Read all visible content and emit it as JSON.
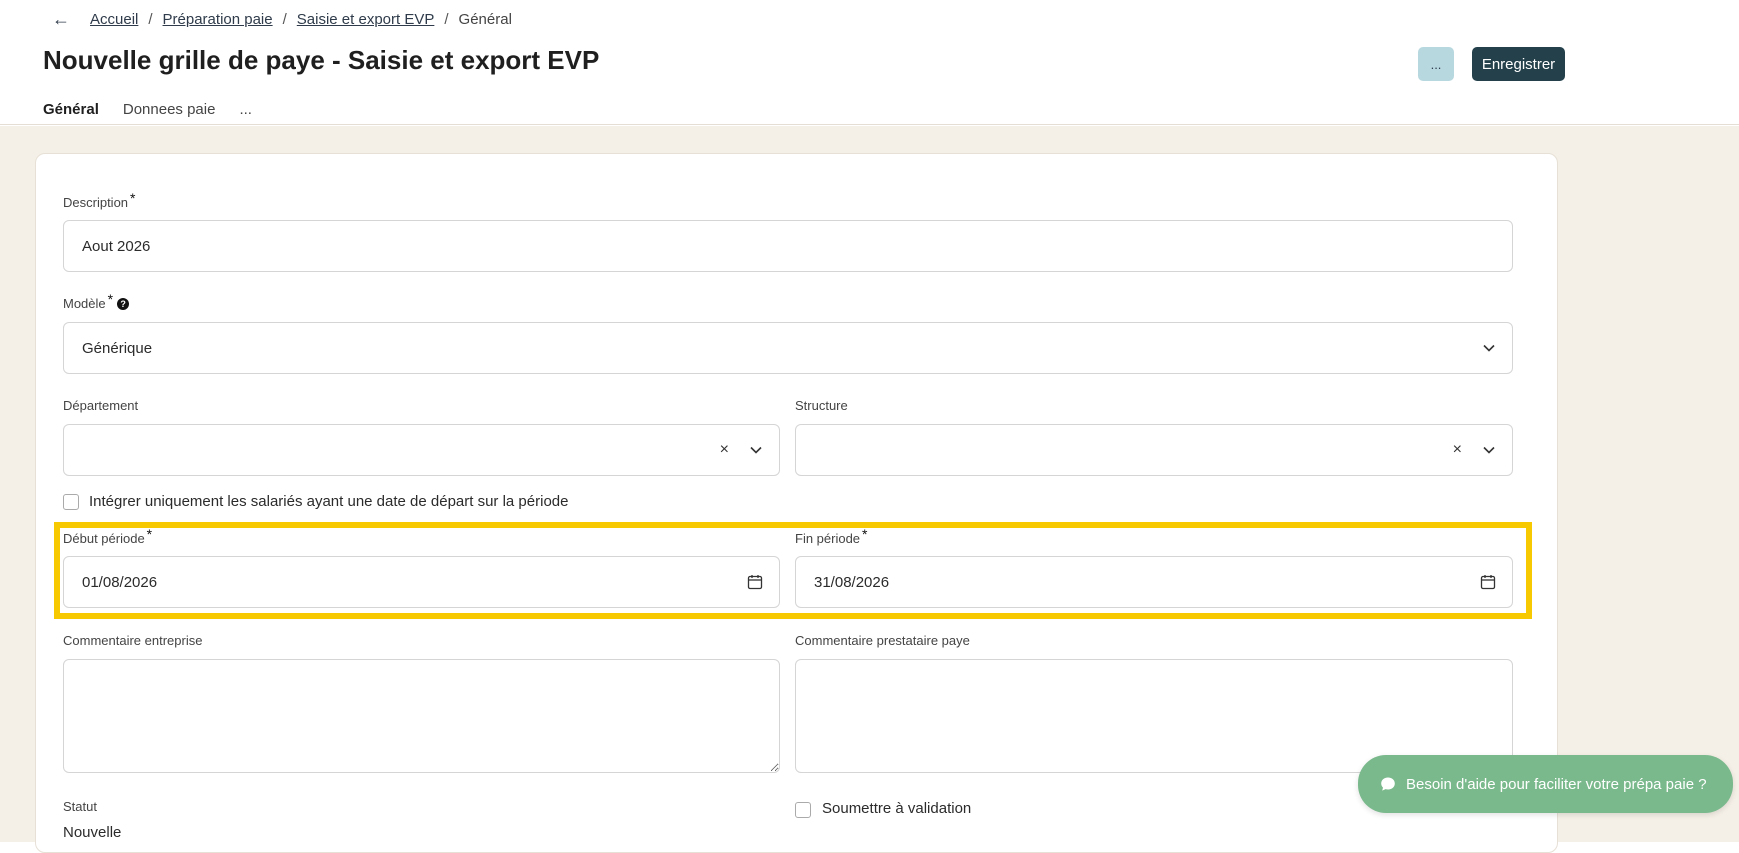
{
  "breadcrumb": {
    "back": "←",
    "items": [
      "Accueil",
      "Préparation paie",
      "Saisie et export EVP"
    ],
    "current": "Général",
    "separator": "/"
  },
  "header": {
    "title": "Nouvelle grille de paye - Saisie et export EVP",
    "more_label": "...",
    "save_label": "Enregistrer"
  },
  "tabs": [
    {
      "label": "Général",
      "active": true
    },
    {
      "label": "Donnees paie",
      "active": false
    },
    {
      "label": "...",
      "active": false
    }
  ],
  "form": {
    "description": {
      "label": "Description",
      "required": "*",
      "value": "Aout 2026"
    },
    "modele": {
      "label": "Modèle",
      "required": "*",
      "help": "?",
      "value": "Générique"
    },
    "departement": {
      "label": "Département",
      "value": "",
      "clear": "×"
    },
    "structure": {
      "label": "Structure",
      "value": "",
      "clear": "×"
    },
    "integrer_label": "Intégrer uniquement les salariés ayant une date de départ sur la période",
    "debut_periode": {
      "label": "Début période",
      "required": "*",
      "value": "01/08/2026"
    },
    "fin_periode": {
      "label": "Fin période",
      "required": "*",
      "value": "31/08/2026"
    },
    "commentaire_entreprise": {
      "label": "Commentaire entreprise",
      "value": ""
    },
    "commentaire_prestataire": {
      "label": "Commentaire prestataire paye",
      "value": ""
    },
    "statut": {
      "label": "Statut",
      "value": "Nouvelle"
    },
    "soumettre_label": "Soumettre à validation"
  },
  "help_bubble": {
    "label": "Besoin d'aide pour faciliter votre prépa paie ?"
  },
  "colors": {
    "primary": "#24404a",
    "secondary_button": "#b8d8e0",
    "page_background": "#f5f0e7",
    "highlight": "#f6c900",
    "help_bubble": "#7ab98c"
  },
  "icons": [
    "back-arrow-icon",
    "chevron-down-icon",
    "clear-icon",
    "calendar-icon",
    "help-icon",
    "chat-icon"
  ]
}
